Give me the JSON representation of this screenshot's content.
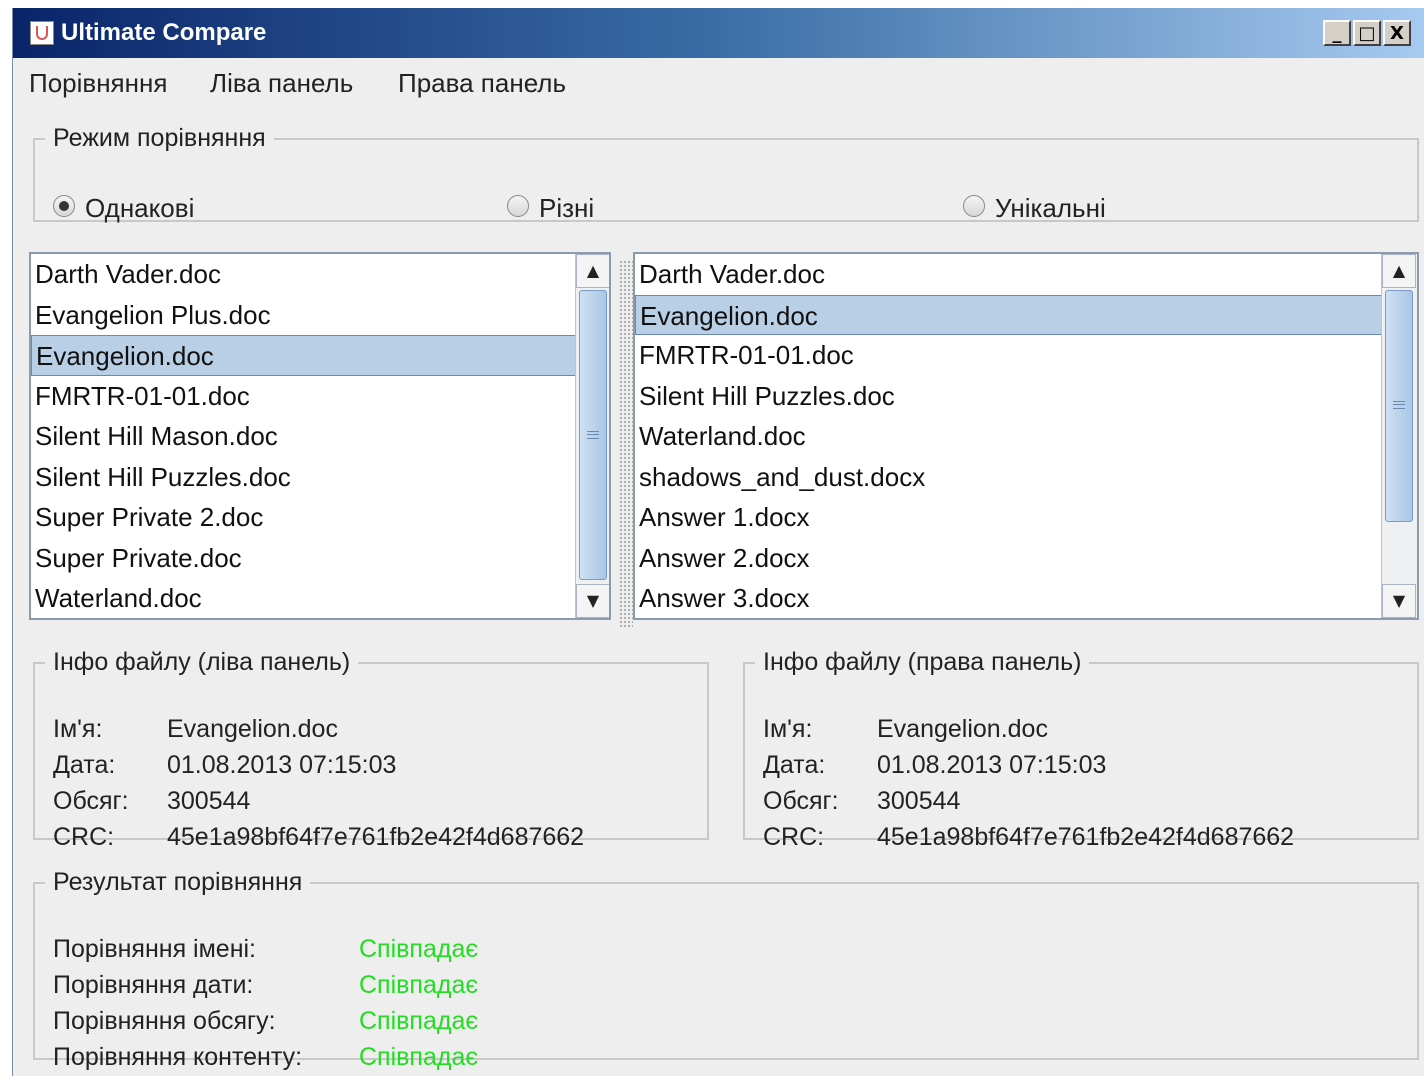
{
  "window": {
    "title": "Ultimate Compare",
    "controls": [
      "_",
      "□",
      "X"
    ]
  },
  "menu": [
    "Порівняння",
    "Ліва панель",
    "Права панель"
  ],
  "mode": {
    "legend": "Режим порівняння",
    "options": [
      {
        "label": "Однакові",
        "selected": true
      },
      {
        "label": "Різні",
        "selected": false
      },
      {
        "label": "Унікальні",
        "selected": false
      }
    ]
  },
  "left_list": {
    "items": [
      "Darth Vader.doc",
      "Evangelion Plus.doc",
      "Evangelion.doc",
      "FMRTR-01-01.doc",
      "Silent Hill Mason.doc",
      "Silent Hill Puzzles.doc",
      "Super Private 2.doc",
      "Super Private.doc",
      "Waterland.doc"
    ],
    "selected": "Evangelion.doc"
  },
  "right_list": {
    "items": [
      "Darth Vader.doc",
      "Evangelion.doc",
      "FMRTR-01-01.doc",
      "Silent Hill Puzzles.doc",
      "Waterland.doc",
      "shadows_and_dust.docx",
      "Answer 1.docx",
      "Answer 2.docx",
      "Answer 3.docx"
    ],
    "selected": "Evangelion.doc"
  },
  "left_info": {
    "legend": "Інфо файлу (ліва панель)",
    "name_label": "Ім'я:",
    "name": "Evangelion.doc",
    "date_label": "Дата:",
    "date": "01.08.2013 07:15:03",
    "size_label": "Обсяг:",
    "size": "300544",
    "crc_label": "CRC:",
    "crc": "45e1a98bf64f7e761fb2e42f4d687662"
  },
  "right_info": {
    "legend": "Інфо файлу (права панель)",
    "name_label": "Ім'я:",
    "name": "Evangelion.doc",
    "date_label": "Дата:",
    "date": "01.08.2013 07:15:03",
    "size_label": "Обсяг:",
    "size": "300544",
    "crc_label": "CRC:",
    "crc": "45e1a98bf64f7e761fb2e42f4d687662"
  },
  "result": {
    "legend": "Результат порівняння",
    "rows": [
      {
        "label": "Порівняння імені:",
        "value": "Співпадає"
      },
      {
        "label": "Порівняння дати:",
        "value": "Співпадає"
      },
      {
        "label": "Порівняння обсягу:",
        "value": "Співпадає"
      },
      {
        "label": "Порівняння контенту:",
        "value": "Співпадає"
      }
    ]
  },
  "colors": {
    "match": "#22dd22",
    "selection": "#b8cfe5",
    "titlebar": "#0a246a"
  }
}
